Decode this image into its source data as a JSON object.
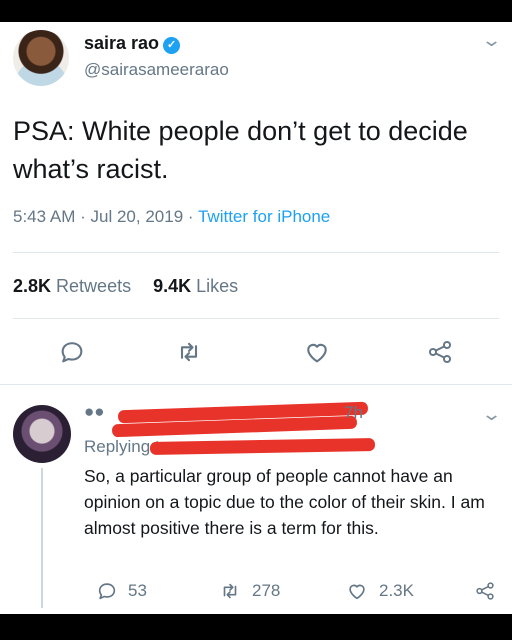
{
  "tweet": {
    "author_name": "saira rao",
    "verified_mark": "✓",
    "handle": "@sairasameerarao",
    "text": "PSA: White people don’t get to decide what’s racist.",
    "time": "5:43 AM",
    "date": "Jul 20, 2019",
    "separator": "·",
    "source": "Twitter for iPhone",
    "retweets_count": "2.8K",
    "retweets_label": "Retweets",
    "likes_count": "9.4K",
    "likes_label": "Likes"
  },
  "reply": {
    "time": "7h",
    "replying_label": "Replying to",
    "text": "So, a particular group of people cannot have an opinion on a topic due to the color of their skin. I am almost positive there is a term for this.",
    "reply_count": "53",
    "retweet_count": "278",
    "like_count": "2.3K"
  },
  "icons": {
    "reply": "reply-icon",
    "retweet": "retweet-icon",
    "like": "heart-icon",
    "share": "share-icon",
    "chevron": "chevron-down-icon",
    "verified": "verified-badge-icon"
  },
  "colors": {
    "accent": "#1da1f2",
    "muted": "#657786",
    "text": "#14171a",
    "redaction": "#e8332a"
  }
}
